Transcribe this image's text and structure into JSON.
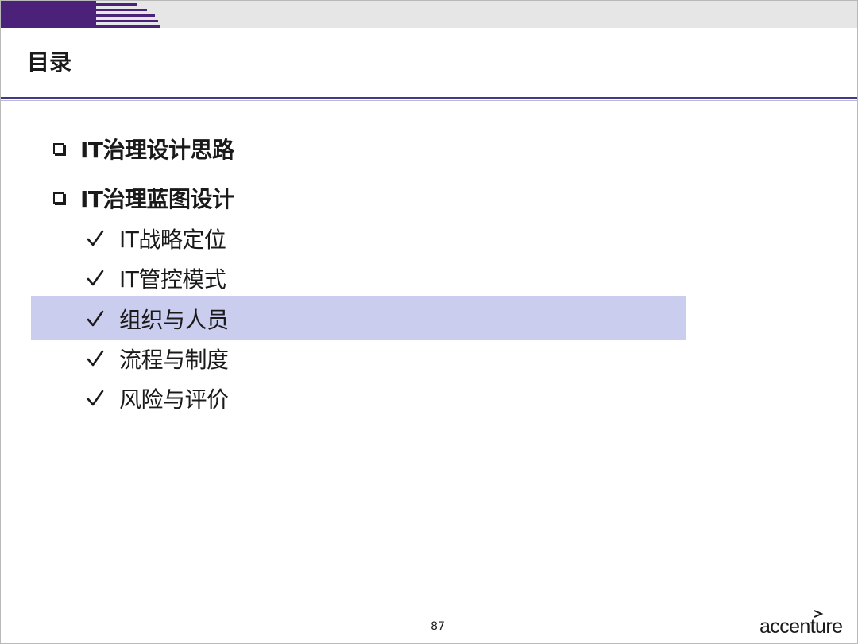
{
  "slide": {
    "title": "目录",
    "page_number": "87"
  },
  "toc": {
    "sections": [
      {
        "label": "IT治理设计思路"
      },
      {
        "label": "IT治理蓝图设计"
      }
    ],
    "sub_items": [
      {
        "label": "IT战略定位",
        "highlighted": false
      },
      {
        "label": "IT管控模式",
        "highlighted": false
      },
      {
        "label": "组织与人员",
        "highlighted": true
      },
      {
        "label": "流程与制度",
        "highlighted": false
      },
      {
        "label": "风险与评价",
        "highlighted": false
      }
    ]
  },
  "brand": {
    "wordmark": "accenture"
  },
  "colors": {
    "accent": "#4b2179",
    "title_rule": "#3f3a86",
    "highlight": "#cbcdee",
    "top_band": "#e6e6e6"
  },
  "icons": {
    "section_bullet": "checkbox-icon",
    "sub_bullet": "checkmark-icon"
  }
}
